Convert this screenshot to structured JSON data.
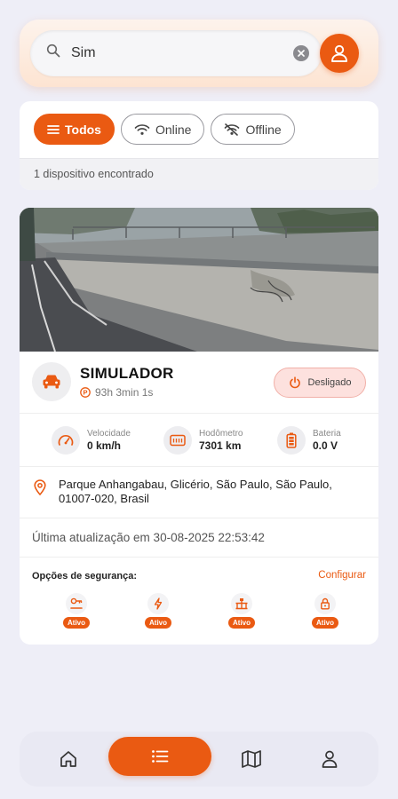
{
  "search": {
    "value": "Sim"
  },
  "filters": [
    {
      "label": "Todos",
      "active": true
    },
    {
      "label": "Online",
      "active": false
    },
    {
      "label": "Offline",
      "active": false
    }
  ],
  "result_count": "1 dispositivo encontrado",
  "device": {
    "name": "SIMULADOR",
    "duration": "93h 3min 1s",
    "status": "Desligado",
    "stats": [
      {
        "label": "Velocidade",
        "value": "0 km/h",
        "icon": "speedometer-icon"
      },
      {
        "label": "Hodômetro",
        "value": "7301 km",
        "icon": "odometer-icon"
      },
      {
        "label": "Bateria",
        "value": "0.0 V",
        "icon": "battery-icon"
      }
    ],
    "address": "Parque Anhangabau, Glicério, São Paulo, São Paulo, 01007-020, Brasil",
    "last_update": "Última atualização em 30-08-2025 22:53:42"
  },
  "security": {
    "title": "Opções de segurança:",
    "config_label": "Configurar",
    "items": [
      {
        "icon": "ignition-key-icon",
        "badge": "Ativo"
      },
      {
        "icon": "power-cut-icon",
        "badge": "Ativo"
      },
      {
        "icon": "anchor-icon",
        "badge": "Ativo"
      },
      {
        "icon": "lock-icon",
        "badge": "Ativo"
      }
    ]
  },
  "nav": [
    "home-icon",
    "list-icon",
    "map-icon",
    "profile-icon"
  ],
  "colors": {
    "accent": "#ea5a12",
    "background": "#eeeef7"
  }
}
